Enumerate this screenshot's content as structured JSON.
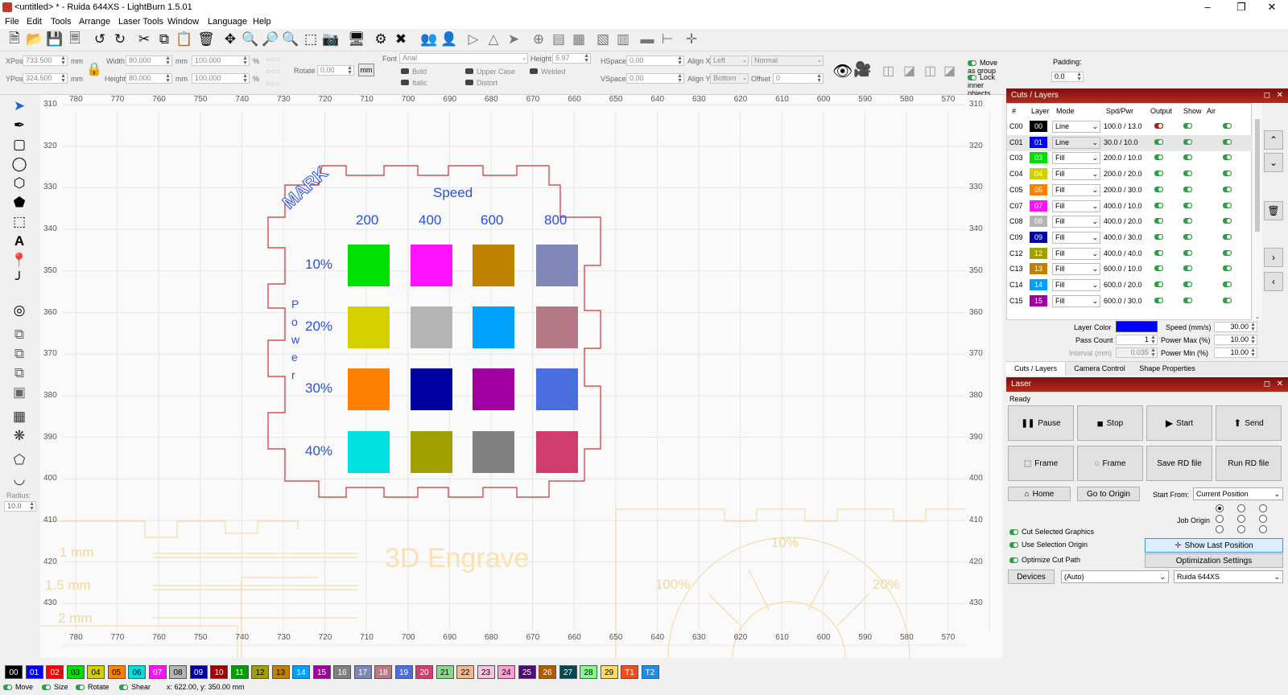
{
  "window": {
    "title": "<untitled> * - Ruida 644XS - LightBurn 1.5.01"
  },
  "menu": [
    "File",
    "Edit",
    "Tools",
    "Arrange",
    "Laser Tools",
    "Window",
    "Language",
    "Help"
  ],
  "props": {
    "xpos_label": "XPos",
    "xpos": "733.500",
    "ypos_label": "YPos",
    "ypos": "324.500",
    "unit": "mm",
    "width_label": "Width",
    "width": "80.000",
    "height_label": "Height",
    "height": "80.000",
    "scale_w": "100.000",
    "scale_h": "100.000",
    "pct": "%",
    "rotate_label": "Rotate",
    "rotate": "0.00",
    "mm_btn": "mm",
    "font_label": "Font",
    "font": "Arial",
    "fheight_label": "Height",
    "fheight": "5.97",
    "bold": "Bold",
    "italic": "Italic",
    "upper": "Upper Case",
    "distort": "Distort",
    "welded": "Welded",
    "hspace_label": "HSpace",
    "hspace": "0.00",
    "vspace_label": "VSpace",
    "vspace": "0.00",
    "alignx_label": "Align X",
    "alignx": "Left",
    "aligny_label": "Align Y",
    "aligny": "Bottom",
    "normal": "Normal",
    "offset_label": "Offset",
    "offset": "0",
    "move_group": "Move as group",
    "lock_inner": "Lock inner objects",
    "padding_label": "Padding:",
    "padding": "0.0"
  },
  "lefttools": {
    "radius_label": "Radius:",
    "radius": "10.0"
  },
  "ruler": {
    "x": [
      "780",
      "770",
      "760",
      "750",
      "740",
      "730",
      "720",
      "710",
      "700",
      "690",
      "680",
      "670",
      "660",
      "650",
      "640",
      "630",
      "620",
      "610",
      "600",
      "590",
      "580",
      "570"
    ],
    "y": [
      "310",
      "320",
      "330",
      "340",
      "350",
      "360",
      "370",
      "380",
      "390",
      "400",
      "410",
      "420",
      "430"
    ]
  },
  "design": {
    "mark": "MARK",
    "speed": "Speed",
    "speeds": [
      "200",
      "400",
      "600",
      "800"
    ],
    "powers": [
      "10%",
      "20%",
      "30%",
      "40%"
    ],
    "power_letters": [
      "P",
      "o",
      "w",
      "e",
      "r"
    ],
    "colors": [
      [
        "#00e000",
        "#ff10ff",
        "#c08000",
        "#7f86b8"
      ],
      [
        "#d4d000",
        "#b4b4b4",
        "#00a0ff",
        "#b47886"
      ],
      [
        "#ff8000",
        "#0000a0",
        "#a000a0",
        "#4a6ee0"
      ],
      [
        "#00e0e0",
        "#a0a000",
        "#808080",
        "#d03c6e"
      ]
    ]
  },
  "ghost": {
    "mm1": "1 mm",
    "mm15": "1.5 mm",
    "mm2": "2 mm",
    "engrave": "3D Engrave",
    "p10": "10%",
    "p100": "100%",
    "p20": "20%"
  },
  "swatches": [
    {
      "l": "00",
      "c": "#000000"
    },
    {
      "l": "01",
      "c": "#0000ff"
    },
    {
      "l": "02",
      "c": "#ff0000"
    },
    {
      "l": "03",
      "c": "#00e000"
    },
    {
      "l": "04",
      "c": "#d4d000"
    },
    {
      "l": "05",
      "c": "#ff8000"
    },
    {
      "l": "06",
      "c": "#00e0e0"
    },
    {
      "l": "07",
      "c": "#ff10ff"
    },
    {
      "l": "08",
      "c": "#b4b4b4"
    },
    {
      "l": "09",
      "c": "#0000a0"
    },
    {
      "l": "10",
      "c": "#a00000"
    },
    {
      "l": "11",
      "c": "#00a000"
    },
    {
      "l": "12",
      "c": "#a0a000"
    },
    {
      "l": "13",
      "c": "#c08000"
    },
    {
      "l": "14",
      "c": "#00a0ff"
    },
    {
      "l": "15",
      "c": "#a000a0"
    },
    {
      "l": "16",
      "c": "#808080"
    },
    {
      "l": "17",
      "c": "#7d87b9"
    },
    {
      "l": "18",
      "c": "#bb7784"
    },
    {
      "l": "19",
      "c": "#4a6fe3"
    },
    {
      "l": "20",
      "c": "#d33f6a"
    },
    {
      "l": "21",
      "c": "#8cd78f"
    },
    {
      "l": "22",
      "c": "#f0b98d"
    },
    {
      "l": "23",
      "c": "#f6c4e1"
    },
    {
      "l": "24",
      "c": "#fa9ed4"
    },
    {
      "l": "25",
      "c": "#500a78"
    },
    {
      "l": "26",
      "c": "#b45a00"
    },
    {
      "l": "27",
      "c": "#004754"
    },
    {
      "l": "28",
      "c": "#86fa88"
    },
    {
      "l": "29",
      "c": "#ffdb66"
    },
    {
      "l": "T1",
      "c": "#f34e1a"
    },
    {
      "l": "T2",
      "c": "#1a8ff3"
    }
  ],
  "status": {
    "move": "Move",
    "size": "Size",
    "rotate": "Rotate",
    "shear": "Shear",
    "coords": "x: 622.00, y: 350.00 mm"
  },
  "cuts": {
    "title": "Cuts / Layers",
    "headers": [
      "#",
      "Layer",
      "Mode",
      "Spd/Pwr",
      "Output",
      "Show",
      "Air"
    ],
    "rows": [
      {
        "id": "C00",
        "n": "00",
        "c": "#000000",
        "m": "Line",
        "sp": "100.0 / 13.0",
        "out": "red"
      },
      {
        "id": "C01",
        "n": "01",
        "c": "#0000ff",
        "m": "Line",
        "sp": "30.0 / 10.0",
        "out": "green"
      },
      {
        "id": "C03",
        "n": "03",
        "c": "#00e000",
        "m": "Fill",
        "sp": "200.0 / 10.0",
        "out": "green"
      },
      {
        "id": "C04",
        "n": "04",
        "c": "#d4d000",
        "m": "Fill",
        "sp": "200.0 / 20.0",
        "out": "green"
      },
      {
        "id": "C05",
        "n": "05",
        "c": "#ff8000",
        "m": "Fill",
        "sp": "200.0 / 30.0",
        "out": "green"
      },
      {
        "id": "C07",
        "n": "07",
        "c": "#ff10ff",
        "m": "Fill",
        "sp": "400.0 / 10.0",
        "out": "green"
      },
      {
        "id": "C08",
        "n": "08",
        "c": "#b4b4b4",
        "m": "Fill",
        "sp": "400.0 / 20.0",
        "out": "green"
      },
      {
        "id": "C09",
        "n": "09",
        "c": "#0000a0",
        "m": "Fill",
        "sp": "400.0 / 30.0",
        "out": "green"
      },
      {
        "id": "C12",
        "n": "12",
        "c": "#a0a000",
        "m": "Fill",
        "sp": "400.0 / 40.0",
        "out": "green"
      },
      {
        "id": "C13",
        "n": "13",
        "c": "#c08000",
        "m": "Fill",
        "sp": "600.0 / 10.0",
        "out": "green"
      },
      {
        "id": "C14",
        "n": "14",
        "c": "#00a0ff",
        "m": "Fill",
        "sp": "600.0 / 20.0",
        "out": "green"
      },
      {
        "id": "C15",
        "n": "15",
        "c": "#a000a0",
        "m": "Fill",
        "sp": "600.0 / 30.0",
        "out": "green"
      }
    ],
    "layer_color": "Layer Color",
    "speed_label": "Speed (mm/s)",
    "speed": "30.00",
    "pass_label": "Pass Count",
    "pass": "1",
    "pmax_label": "Power Max (%)",
    "pmax": "10.00",
    "interval_label": "Interval (mm)",
    "interval": "0.035",
    "pmin_label": "Power Min (%)",
    "pmin": "10.00",
    "tabs": [
      "Cuts / Layers",
      "Camera Control",
      "Shape Properties"
    ]
  },
  "laser": {
    "title": "Laser",
    "status": "Ready",
    "pause": "Pause",
    "stop": "Stop",
    "start": "Start",
    "send": "Send",
    "frame1": "Frame",
    "frame2": "Frame",
    "save_rd": "Save RD file",
    "run_rd": "Run RD file",
    "home": "Home",
    "goto_origin": "Go to Origin",
    "start_from_label": "Start From:",
    "start_from": "Current Position",
    "job_origin": "Job Origin",
    "cut_selected": "Cut Selected Graphics",
    "use_selection": "Use Selection Origin",
    "optimize": "Optimize Cut Path",
    "show_last": "Show Last Position",
    "opt_settings": "Optimization Settings",
    "devices": "Devices",
    "auto": "(Auto)",
    "device": "Ruida 644XS"
  }
}
